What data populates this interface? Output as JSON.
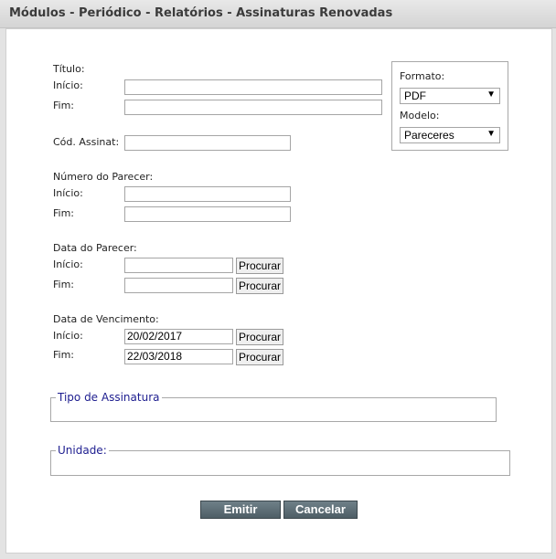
{
  "window": {
    "title": "Módulos - Periódico - Relatórios - Assinaturas Renovadas"
  },
  "form": {
    "titulo": {
      "heading": "Título:",
      "inicio_label": "Início:",
      "fim_label": "Fim:",
      "inicio_value": "",
      "fim_value": ""
    },
    "cod_assinat": {
      "label": "Cód. Assinat:",
      "value": ""
    },
    "numero_parecer": {
      "heading": "Número do Parecer:",
      "inicio_label": "Início:",
      "fim_label": "Fim:",
      "inicio_value": "",
      "fim_value": ""
    },
    "data_parecer": {
      "heading": "Data do Parecer:",
      "inicio_label": "Início:",
      "fim_label": "Fim:",
      "inicio_value": "",
      "fim_value": "",
      "procurar_label": "Procurar"
    },
    "data_vencimento": {
      "heading": "Data de Vencimento:",
      "inicio_label": "Início:",
      "fim_label": "Fim:",
      "inicio_value": "20/02/2017",
      "fim_value": "22/03/2018",
      "procurar_label": "Procurar"
    },
    "tipo_assinatura": {
      "legend": "Tipo de Assinatura"
    },
    "unidade": {
      "legend": "Unidade:"
    }
  },
  "options": {
    "formato": {
      "label": "Formato:",
      "selected": "PDF"
    },
    "modelo": {
      "label": "Modelo:",
      "selected": "Pareceres"
    }
  },
  "actions": {
    "emitir": "Emitir",
    "cancelar": "Cancelar"
  },
  "icons": {
    "dropdown": "chevron-down-icon"
  }
}
